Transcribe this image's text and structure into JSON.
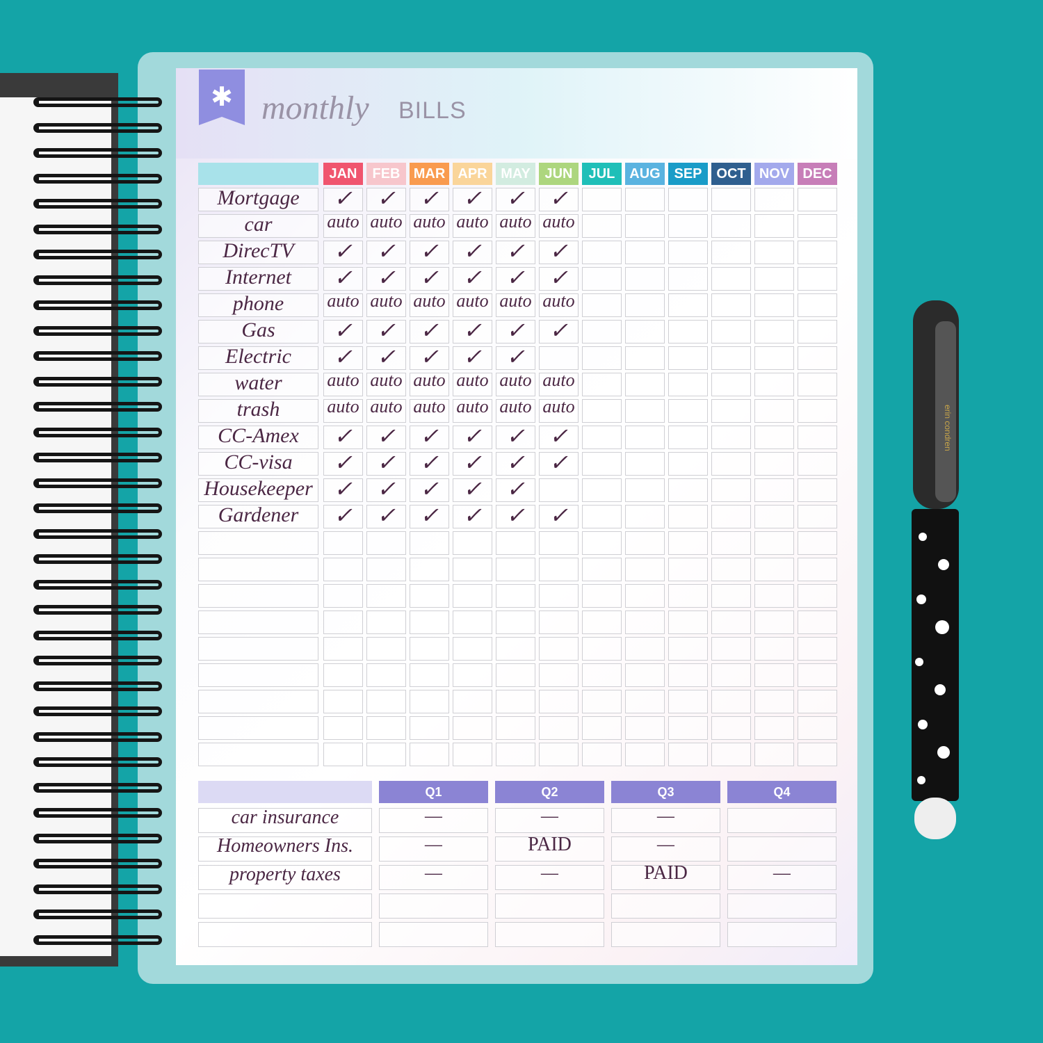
{
  "title": {
    "script": "monthly",
    "caps": "BILLS",
    "ribbon_icon": "asterisk-icon"
  },
  "colors": {
    "background": "#14a4a7",
    "ink": "#4b2744",
    "label_header": "#a8e2ea",
    "quarter_header": "#8b84d4",
    "label_quarter_header": "#dcdaf4"
  },
  "months": [
    {
      "label": "JAN",
      "color": "#f0556e"
    },
    {
      "label": "FEB",
      "color": "#f7c6cc"
    },
    {
      "label": "MAR",
      "color": "#f99b4f"
    },
    {
      "label": "APR",
      "color": "#fad59a"
    },
    {
      "label": "MAY",
      "color": "#d2ece0"
    },
    {
      "label": "JUN",
      "color": "#add67e"
    },
    {
      "label": "JUL",
      "color": "#1fbfb8"
    },
    {
      "label": "AUG",
      "color": "#5ab3e0"
    },
    {
      "label": "SEP",
      "color": "#1a9cc8"
    },
    {
      "label": "OCT",
      "color": "#2f5f8f"
    },
    {
      "label": "NOV",
      "color": "#a3a9ec"
    },
    {
      "label": "DEC",
      "color": "#c77eb8"
    }
  ],
  "bills": [
    {
      "name": "Mortgage",
      "marks": [
        "✓",
        "✓",
        "✓",
        "✓",
        "✓",
        "✓"
      ]
    },
    {
      "name": "car",
      "marks": [
        "auto",
        "auto",
        "auto",
        "auto",
        "auto",
        "auto"
      ]
    },
    {
      "name": "DirecTV",
      "marks": [
        "✓",
        "✓",
        "✓",
        "✓",
        "✓",
        "✓"
      ]
    },
    {
      "name": "Internet",
      "marks": [
        "✓",
        "✓",
        "✓",
        "✓",
        "✓",
        "✓"
      ]
    },
    {
      "name": "phone",
      "marks": [
        "auto",
        "auto",
        "auto",
        "auto",
        "auto",
        "auto"
      ]
    },
    {
      "name": "Gas",
      "marks": [
        "✓",
        "✓",
        "✓",
        "✓",
        "✓",
        "✓"
      ]
    },
    {
      "name": "Electric",
      "marks": [
        "✓",
        "✓",
        "✓",
        "✓",
        "✓",
        ""
      ]
    },
    {
      "name": "water",
      "marks": [
        "auto",
        "auto",
        "auto",
        "auto",
        "auto",
        "auto"
      ]
    },
    {
      "name": "trash",
      "marks": [
        "auto",
        "auto",
        "auto",
        "auto",
        "auto",
        "auto"
      ]
    },
    {
      "name": "CC-Amex",
      "marks": [
        "✓",
        "✓",
        "✓",
        "✓",
        "✓",
        "✓"
      ]
    },
    {
      "name": "CC-visa",
      "marks": [
        "✓",
        "✓",
        "✓",
        "✓",
        "✓",
        "✓"
      ]
    },
    {
      "name": "Housekeeper",
      "marks": [
        "✓",
        "✓",
        "✓",
        "✓",
        "✓",
        ""
      ]
    },
    {
      "name": "Gardener",
      "marks": [
        "✓",
        "✓",
        "✓",
        "✓",
        "✓",
        "✓"
      ]
    }
  ],
  "quarters": [
    "Q1",
    "Q2",
    "Q3",
    "Q4"
  ],
  "quarterly_bills": [
    {
      "name": "car insurance",
      "marks": [
        "—",
        "—",
        "—",
        ""
      ]
    },
    {
      "name": "Homeowners Ins.",
      "marks": [
        "—",
        "PAID",
        "—",
        ""
      ]
    },
    {
      "name": "property taxes",
      "marks": [
        "—",
        "—",
        "PAID",
        "—"
      ]
    }
  ],
  "pen": {
    "brand": "erin condren"
  }
}
